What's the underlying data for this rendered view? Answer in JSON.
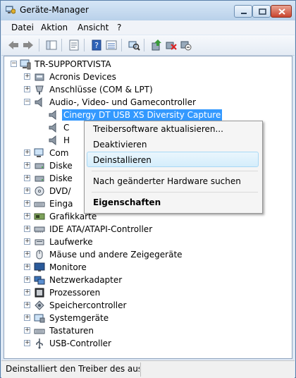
{
  "window": {
    "title": "Geräte-Manager"
  },
  "menubar": {
    "items": [
      "Datei",
      "Aktion",
      "Ansicht",
      "?"
    ]
  },
  "toolbar": {
    "icons": [
      "back-icon",
      "forward-icon",
      "tree-view-icon",
      "properties-icon",
      "help-icon",
      "details-icon",
      "scan-hardware-icon",
      "update-driver-icon",
      "uninstall-icon",
      "disable-icon"
    ]
  },
  "tree": {
    "root": "TR-SUPPORTVISTA",
    "items": [
      {
        "label": "Acronis Devices",
        "icon": "device-icon"
      },
      {
        "label": "Anschlüsse (COM & LPT)",
        "icon": "port-icon"
      },
      {
        "label": "Audio-, Video- und Gamecontroller",
        "icon": "speaker-icon"
      },
      {
        "label": "Cinergy DT USB XS Diversity Capture",
        "icon": "speaker-icon"
      },
      {
        "label": "C",
        "icon": "speaker-icon"
      },
      {
        "label": "H",
        "icon": "speaker-icon"
      },
      {
        "label": "Com",
        "icon": "computer-icon"
      },
      {
        "label": "Diske",
        "icon": "disk-icon"
      },
      {
        "label": "Diske",
        "icon": "disk-icon"
      },
      {
        "label": "DVD/",
        "icon": "dvd-icon"
      },
      {
        "label": "Einga",
        "icon": "keyboard-icon"
      },
      {
        "label": "Grafikkarte",
        "icon": "display-adapter-icon"
      },
      {
        "label": "IDE ATA/ATAPI-Controller",
        "icon": "controller-icon"
      },
      {
        "label": "Laufwerke",
        "icon": "drive-icon"
      },
      {
        "label": "Mäuse und andere Zeigegeräte",
        "icon": "mouse-icon"
      },
      {
        "label": "Monitore",
        "icon": "monitor-icon"
      },
      {
        "label": "Netzwerkadapter",
        "icon": "network-icon"
      },
      {
        "label": "Prozessoren",
        "icon": "processor-icon"
      },
      {
        "label": "Speichercontroller",
        "icon": "storage-icon"
      },
      {
        "label": "Systemgeräte",
        "icon": "system-icon"
      },
      {
        "label": "Tastaturen",
        "icon": "keyboard-icon"
      },
      {
        "label": "USB-Controller",
        "icon": "usb-icon"
      }
    ]
  },
  "context_menu": {
    "update": "Treibersoftware aktualisieren...",
    "disable": "Deaktivieren",
    "uninstall": "Deinstallieren",
    "scan": "Nach geänderter Hardware suchen",
    "properties": "Eigenschaften"
  },
  "statusbar": {
    "text": "Deinstalliert den Treiber des ausgew"
  },
  "colors": {
    "selection": "#3399ff",
    "hover": "#d4edfb"
  }
}
